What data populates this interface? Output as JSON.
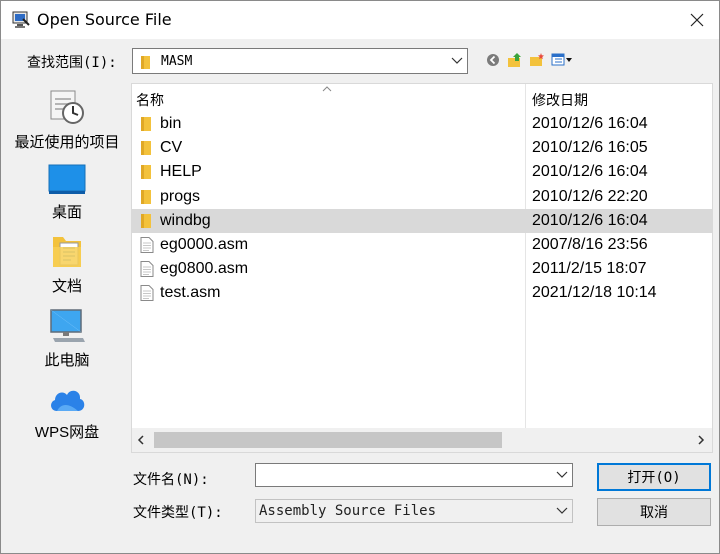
{
  "window": {
    "title": "Open Source File"
  },
  "lookin": {
    "label": "查找范围(I):",
    "value": "MASM"
  },
  "places": [
    {
      "label": "最近使用的项目",
      "icon": "recent-items-icon"
    },
    {
      "label": "桌面",
      "icon": "desktop-icon"
    },
    {
      "label": "文档",
      "icon": "documents-icon"
    },
    {
      "label": "此电脑",
      "icon": "this-pc-icon"
    },
    {
      "label": "WPS网盘",
      "icon": "wps-cloud-icon"
    }
  ],
  "columns": {
    "name": "名称",
    "modified": "修改日期"
  },
  "files": [
    {
      "name": "bin",
      "date": "2010/12/6 16:04",
      "type": "folder"
    },
    {
      "name": "CV",
      "date": "2010/12/6 16:05",
      "type": "folder"
    },
    {
      "name": "HELP",
      "date": "2010/12/6 16:04",
      "type": "folder"
    },
    {
      "name": "progs",
      "date": "2010/12/6 22:20",
      "type": "folder"
    },
    {
      "name": "windbg",
      "date": "2010/12/6 16:04",
      "type": "folder",
      "selected": true
    },
    {
      "name": "eg0000.asm",
      "date": "2007/8/16 23:56",
      "type": "file"
    },
    {
      "name": "eg0800.asm",
      "date": "2011/2/15 18:07",
      "type": "file"
    },
    {
      "name": "test.asm",
      "date": "2021/12/18 10:14",
      "type": "file"
    }
  ],
  "filename": {
    "label": "文件名(N):",
    "value": "",
    "placeholder": ""
  },
  "filetype": {
    "label": "文件类型(T):",
    "value": "Assembly Source Files"
  },
  "buttons": {
    "open": "打开(O)",
    "cancel": "取消"
  },
  "colors": {
    "selection": "#d9d9d9",
    "folder": "#f3c23c",
    "accent": "#0078d7"
  }
}
